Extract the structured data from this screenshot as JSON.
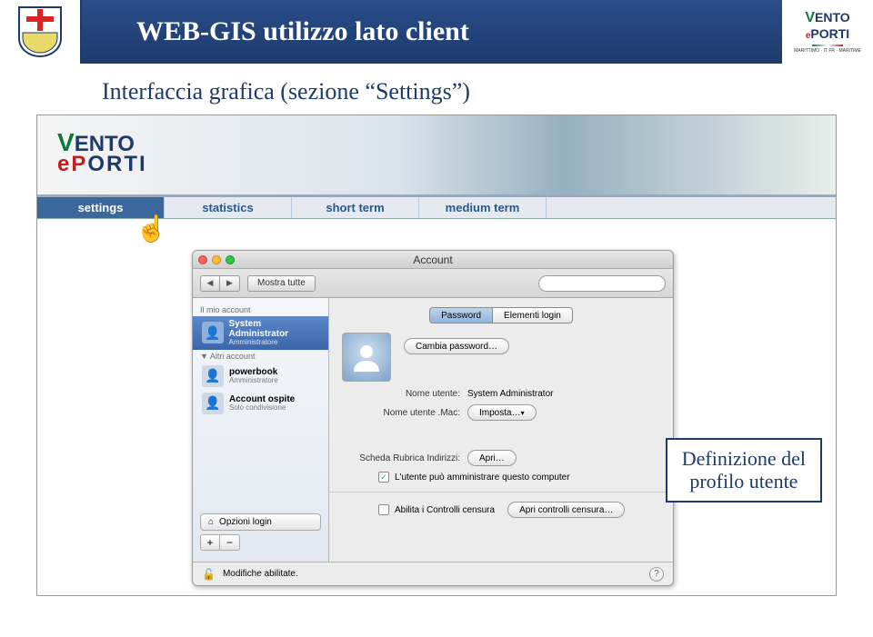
{
  "header": {
    "title": "WEB-GIS utilizzo lato client"
  },
  "subtitle": "Interfaccia grafica (sezione “Settings”)",
  "banner": {
    "logo_line1_green": "V",
    "logo_line1_red": "e",
    "logo_line1_blue": "ENTO",
    "logo_line2_red": "P",
    "logo_line2_blue": "ORTI"
  },
  "tabs": [
    {
      "label": "settings",
      "active": true
    },
    {
      "label": "statistics",
      "active": false
    },
    {
      "label": "short term",
      "active": false
    },
    {
      "label": "medium term",
      "active": false
    }
  ],
  "mac": {
    "title": "Account",
    "show_all": "Mostra tutte",
    "search_placeholder": "",
    "sidebar": {
      "my_account_label": "Il mio account",
      "sysadmin_name": "System Administrator",
      "sysadmin_role": "Amministratore",
      "other_accounts_label": "Altri account",
      "powerbook_name": "powerbook",
      "powerbook_role": "Amministratore",
      "guest_name": "Account ospite",
      "guest_role": "Solo condivisione",
      "login_options": "Opzioni login"
    },
    "content": {
      "tab_password": "Password",
      "tab_login": "Elementi login",
      "change_password": "Cambia password…",
      "name_label": "Nome utente:",
      "name_value": "System Administrator",
      "dotmac_label": "Nome utente .Mac:",
      "dotmac_value": "Imposta…",
      "address_label": "Scheda Rubrica Indirizzi:",
      "address_btn": "Apri…",
      "admin_check": "L'utente può amministrare questo computer",
      "parental_check": "Abilita i Controlli censura",
      "parental_btn": "Apri controlli censura…"
    },
    "footer": "Modifiche abilitate."
  },
  "callout": {
    "line1": "Definizione del",
    "line2": "profilo utente"
  }
}
